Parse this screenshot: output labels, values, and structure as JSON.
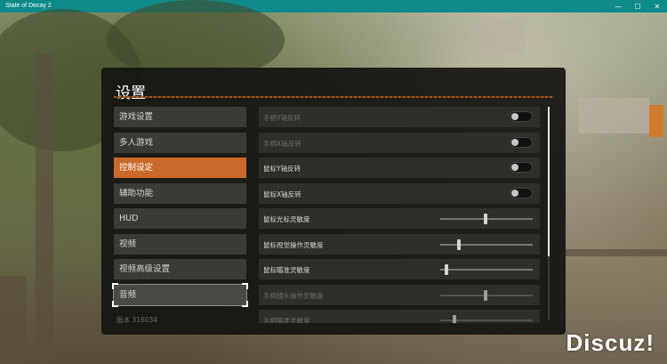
{
  "window": {
    "title": "State of Decay 2",
    "buttons": [
      "—",
      "☐",
      "✕"
    ]
  },
  "panel": {
    "title": "设置",
    "version": "版本 316034"
  },
  "nav": {
    "items": [
      {
        "label": "游戏设置",
        "state": "normal"
      },
      {
        "label": "多人游戏",
        "state": "normal"
      },
      {
        "label": "控制设定",
        "state": "active"
      },
      {
        "label": "辅助功能",
        "state": "normal"
      },
      {
        "label": "HUD",
        "state": "normal"
      },
      {
        "label": "视频",
        "state": "normal"
      },
      {
        "label": "视频高级设置",
        "state": "normal"
      },
      {
        "label": "音频",
        "state": "focused"
      }
    ]
  },
  "settings": {
    "rows": [
      {
        "label": "手柄Y轴反转",
        "control": "toggle",
        "on": false,
        "disabled": true
      },
      {
        "label": "手柄X轴反转",
        "control": "toggle",
        "on": false,
        "disabled": true
      },
      {
        "label": "鼠标Y轴反转",
        "control": "toggle",
        "on": false,
        "disabled": false
      },
      {
        "label": "鼠标X轴反转",
        "control": "toggle",
        "on": false,
        "disabled": false
      },
      {
        "label": "鼠标光标灵敏度",
        "control": "slider",
        "value": 0.49,
        "disabled": false
      },
      {
        "label": "鼠标视觉操作灵敏度",
        "control": "slider",
        "value": 0.2,
        "disabled": false
      },
      {
        "label": "鼠标瞄准灵敏度",
        "control": "slider",
        "value": 0.07,
        "disabled": false
      },
      {
        "label": "手柄镜头操作灵敏度",
        "control": "slider",
        "value": 0.49,
        "disabled": true
      },
      {
        "label": "手柄瞄准灵敏度",
        "control": "slider",
        "value": 0.15,
        "disabled": true
      }
    ],
    "scroll_fraction": 0.7
  },
  "watermark": "Discuz!",
  "colors": {
    "titlebar": "#0f8a8a",
    "accent": "#c96a2a",
    "panel_bg": "#161412",
    "row_bg": "#2f2e2a",
    "nav_bg": "#3b3a35"
  }
}
